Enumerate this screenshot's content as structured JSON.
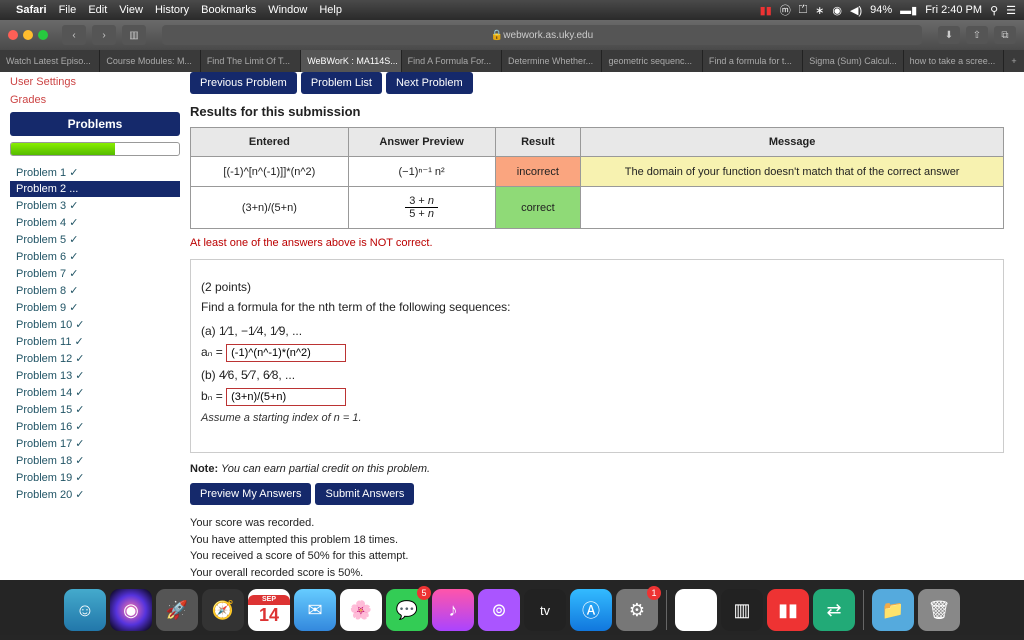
{
  "menubar": {
    "app": "Safari",
    "items": [
      "File",
      "Edit",
      "View",
      "History",
      "Bookmarks",
      "Window",
      "Help"
    ],
    "battery": "94%",
    "time": "Fri 2:40 PM"
  },
  "url": "webwork.as.uky.edu",
  "tabs": [
    "Watch Latest Episo...",
    "Course Modules: M...",
    "Find The Limit Of T...",
    "WeBWorK : MA114S...",
    "Find A Formula For...",
    "Determine Whether...",
    "geometric sequenc...",
    "Find a formula for t...",
    "Sigma (Sum) Calcul...",
    "how to take a scree..."
  ],
  "active_tab": 3,
  "sidebar": {
    "top": "User Settings",
    "grades": "Grades",
    "section": "Problems",
    "problems": [
      "Problem 1 ✓",
      "Problem 2 ...",
      "Problem 3 ✓",
      "Problem 4 ✓",
      "Problem 5 ✓",
      "Problem 6 ✓",
      "Problem 7 ✓",
      "Problem 8 ✓",
      "Problem 9 ✓",
      "Problem 10 ✓",
      "Problem 11 ✓",
      "Problem 12 ✓",
      "Problem 13 ✓",
      "Problem 14 ✓",
      "Problem 15 ✓",
      "Problem 16 ✓",
      "Problem 17 ✓",
      "Problem 18 ✓",
      "Problem 19 ✓",
      "Problem 20 ✓"
    ],
    "selected": 1
  },
  "topbtns": [
    "Previous Problem",
    "Problem List",
    "Next Problem"
  ],
  "results": {
    "heading": "Results for this submission",
    "headers": [
      "Entered",
      "Answer Preview",
      "Result",
      "Message"
    ],
    "rows": [
      {
        "entered": "[(-1)^[n^(-1)]]*(n^2)",
        "preview": "(−1)ⁿ⁻¹ n²",
        "result": "incorrect",
        "result_cls": "cell-inc",
        "message": "The domain of your function doesn't match that of the correct answer"
      },
      {
        "entered": "(3+n)/(5+n)",
        "preview_html": "(3 + n) / (5 + n)",
        "result": "correct",
        "result_cls": "cell-cor",
        "message": ""
      }
    ],
    "err": "At least one of the answers above is NOT correct."
  },
  "problem": {
    "points": "(2 points)",
    "prompt": "Find a formula for the nth term of the following sequences:",
    "a_seq": "(a) 1⁄1, −1⁄4, 1⁄9, ...",
    "a_label": "aₙ =",
    "a_val": "(-1)^(n^-1)*(n^2)",
    "b_seq": "(b) 4⁄6, 5⁄7, 6⁄8, ...",
    "b_label": "bₙ =",
    "b_val": "(3+n)/(5+n)",
    "assume": "Assume a starting index of n = 1.",
    "note_lbl": "Note:",
    "note": " You can earn partial credit on this problem.",
    "btn_preview": "Preview My Answers",
    "btn_submit": "Submit Answers",
    "score": [
      "Your score was recorded.",
      "You have attempted this problem 18 times.",
      "You received a score of 50% for this attempt.",
      "Your overall recorded score is 50%."
    ]
  },
  "dock": {
    "calendar_day": "14",
    "msg_badge": "5",
    "sys_badge": "1"
  }
}
